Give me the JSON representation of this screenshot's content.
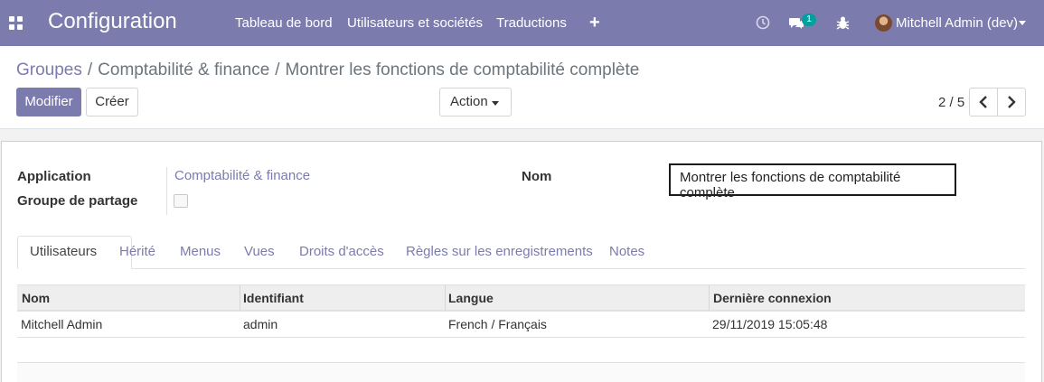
{
  "navbar": {
    "app_title": "Configuration",
    "menu": [
      "Tableau de bord",
      "Utilisateurs et sociétés",
      "Traductions"
    ],
    "plus_icon": "+",
    "messages_badge": "1",
    "user": "Mitchell Admin (dev)",
    "brand_color": "#7c7bad"
  },
  "breadcrumb": {
    "root": "Groupes",
    "separator": "/",
    "middle": "Comptabilité & finance",
    "current": "Montrer les fonctions de comptabilité complète"
  },
  "buttons": {
    "edit": "Modifier",
    "create": "Créer",
    "action": "Action"
  },
  "pager": {
    "value": "2 / 5"
  },
  "form": {
    "application_label": "Application",
    "application_value": "Comptabilité & finance",
    "share_label": "Groupe de partage",
    "share_checked": false,
    "name_label": "Nom",
    "name_value": "Montrer les fonctions de comptabilité complète"
  },
  "tabs": [
    "Utilisateurs",
    "Hérité",
    "Menus",
    "Vues",
    "Droits d'accès",
    "Règles sur les enregistrements",
    "Notes"
  ],
  "active_tab": "Utilisateurs",
  "table": {
    "columns": [
      "Nom",
      "Identifiant",
      "Langue",
      "Dernière connexion"
    ],
    "rows": [
      [
        "Mitchell Admin",
        "admin",
        "French / Français",
        "29/11/2019 15:05:48"
      ]
    ]
  }
}
